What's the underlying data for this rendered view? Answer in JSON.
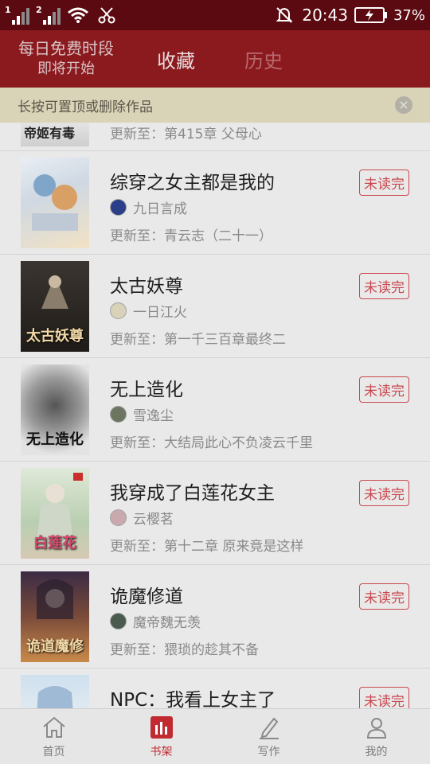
{
  "status_bar": {
    "sim1": "1",
    "sim2": "2",
    "time": "20:43",
    "battery_pct": "37%",
    "battery_level": 0.37
  },
  "header": {
    "free_period_line1": "每日免费时段",
    "free_period_line2": "即将开始",
    "tabs": [
      {
        "label": "收藏",
        "active": true
      },
      {
        "label": "历史",
        "active": false
      }
    ]
  },
  "hint": {
    "text": "长按可置顶或删除作品",
    "close_glyph": "×"
  },
  "partial_item": {
    "cover_text": "帝姬有毒",
    "update": "更新至：第415章 父母心"
  },
  "books": [
    {
      "title": "综穿之女主都是我的",
      "author": "九日言成",
      "update": "更新至：青云志（二十一）",
      "badge": "未读完"
    },
    {
      "title": "太古妖尊",
      "author": "一日江火",
      "update": "更新至：第一千三百章最终二",
      "badge": "未读完",
      "cover_text": "太古妖尊"
    },
    {
      "title": "无上造化",
      "author": "雪逸尘",
      "update": "更新至：大结局此心不负凌云千里",
      "badge": "未读完",
      "cover_text": "无上造化"
    },
    {
      "title": "我穿成了白莲花女主",
      "author": "云樱茗",
      "update": "更新至：第十二章 原来竟是这样",
      "badge": "未读完",
      "cover_text": "白莲花"
    },
    {
      "title": "诡魔修道",
      "author": "魔帝魏无羡",
      "update": "更新至：猥琐的趁其不备",
      "badge": "未读完",
      "cover_text": "诡道魔修"
    },
    {
      "title": "NPC：我看上女主了",
      "author": "",
      "update": "",
      "badge": "未读完"
    }
  ],
  "bottom_nav": [
    {
      "label": "首页",
      "icon": "home-icon",
      "active": false
    },
    {
      "label": "书架",
      "icon": "bookshelf-icon",
      "active": true
    },
    {
      "label": "写作",
      "icon": "pen-icon",
      "active": false
    },
    {
      "label": "我的",
      "icon": "person-icon",
      "active": false
    }
  ],
  "colors": {
    "status_bar": "#5a0a10",
    "header": "#8b1a1f",
    "hint_bar": "#d9d3b8",
    "accent": "#c02a30",
    "list_bg": "#e9e9e9"
  }
}
